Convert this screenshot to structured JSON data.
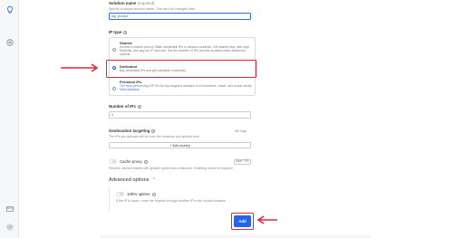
{
  "sidebar": {
    "icons": [
      "bulb-icon",
      "settings-icon",
      "card-icon",
      "gear-icon"
    ]
  },
  "form": {
    "solution_name": {
      "label": "Solution name",
      "optional": "(required)",
      "help": "Specify a unique solution name. This can't be changed later.",
      "value": "isp_proxy1"
    },
    "ip_type": {
      "label": "IP type",
      "options": [
        {
          "title": "Shared",
          "desc": "Access a shared pool of Static residential IPs in various countries. Get started fast, with high flexibility, and pay per IP and use. Set the number of IPs and the location under Advanced options.",
          "selected": false
        },
        {
          "title": "Dedicated",
          "desc": "Buy dedicated IPs and get complete exclusivity.",
          "selected": true
        },
        {
          "title": "Premium IPs",
          "desc": "The best-performing ISP IPs for top targeted domains in eCommerce, travel, and social media.",
          "link": "View domains",
          "selected": false
        }
      ]
    },
    "num_ips": {
      "label": "Number of IPs",
      "value": "1"
    },
    "geolocation": {
      "label": "Geolocation targeting",
      "badge": "+$0.5/gb",
      "help": "The IPs you allocate will be from the locations you specify here",
      "button": "+ Add country"
    },
    "cache_proxy": {
      "label": "Cache proxy",
      "badge": "Save 70%",
      "help": "Receive cached results with greater speed and a discount. Enabling cache is required"
    },
    "advanced": {
      "title": "Advanced options",
      "uptime_label": "100% uptime",
      "uptime_help": "If the IP is down, route the request through another IP in the located location"
    }
  },
  "actions": {
    "add_label": "Add"
  },
  "colors": {
    "primary": "#2563eb",
    "highlight": "#e0263b"
  }
}
